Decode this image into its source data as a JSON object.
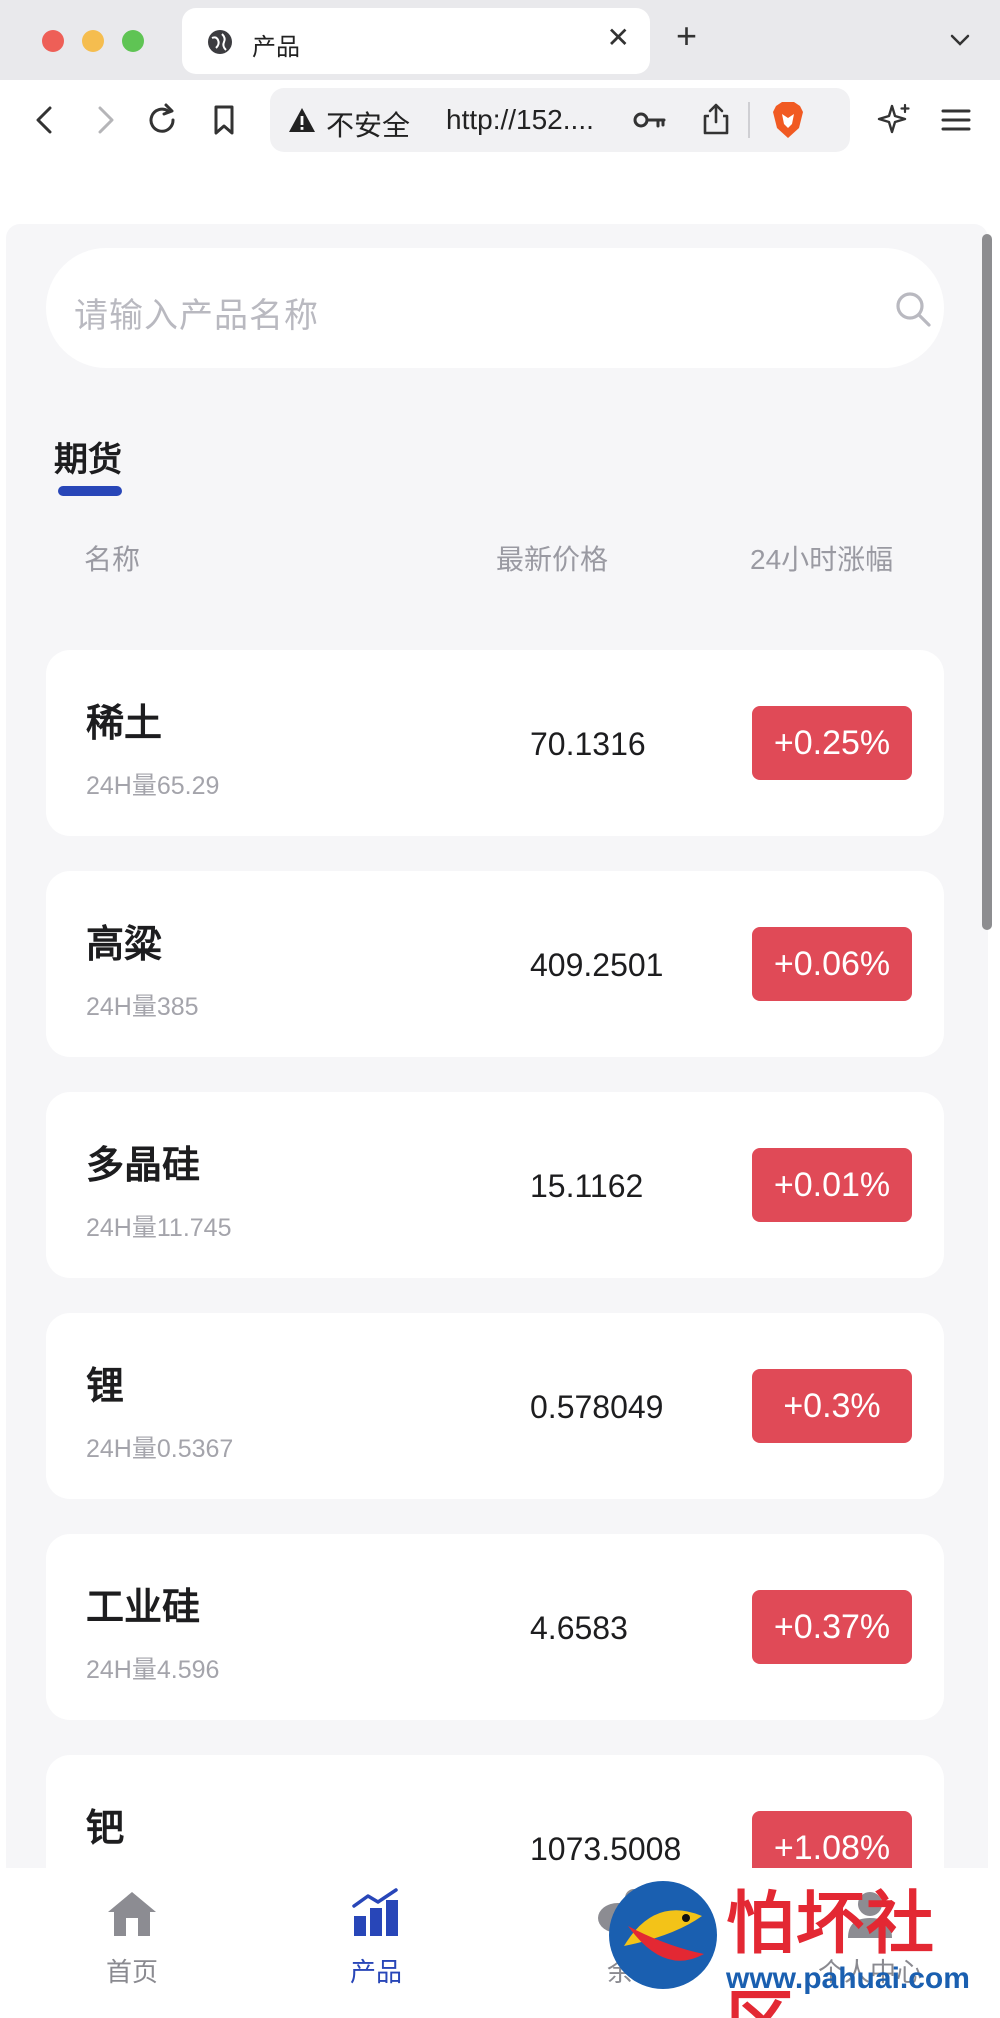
{
  "browser": {
    "tab_title": "产品",
    "new_tab_symbol": "+",
    "close_symbol": "✕",
    "security_label": "不安全",
    "url": "http://152...."
  },
  "search": {
    "placeholder": "请输入产品名称"
  },
  "category_tab": "期货",
  "columns": {
    "name": "名称",
    "price": "最新价格",
    "change": "24小时涨幅"
  },
  "products": [
    {
      "name": "稀土",
      "volume": "24H量65.29",
      "price": "70.1316",
      "change": "+0.25%"
    },
    {
      "name": "高粱",
      "volume": "24H量385",
      "price": "409.2501",
      "change": "+0.06%"
    },
    {
      "name": "多晶硅",
      "volume": "24H量11.745",
      "price": "15.1162",
      "change": "+0.01%"
    },
    {
      "name": "锂",
      "volume": "24H量0.5367",
      "price": "0.578049",
      "change": "+0.3%"
    },
    {
      "name": "工业硅",
      "volume": "24H量4.596",
      "price": "4.6583",
      "change": "+0.37%"
    },
    {
      "name": "钯",
      "volume": "",
      "price": "1073.5008",
      "change": "+1.08%"
    }
  ],
  "bottom_nav": {
    "home": "首页",
    "products": "产品",
    "balance": "余",
    "profile": "个人中心"
  },
  "watermark": {
    "title": "怕坏社区",
    "site": "www.pahuai.com"
  },
  "colors": {
    "accent": "#2846b8",
    "badge_up": "#e04a57",
    "page_bg": "#f6f6f8"
  }
}
